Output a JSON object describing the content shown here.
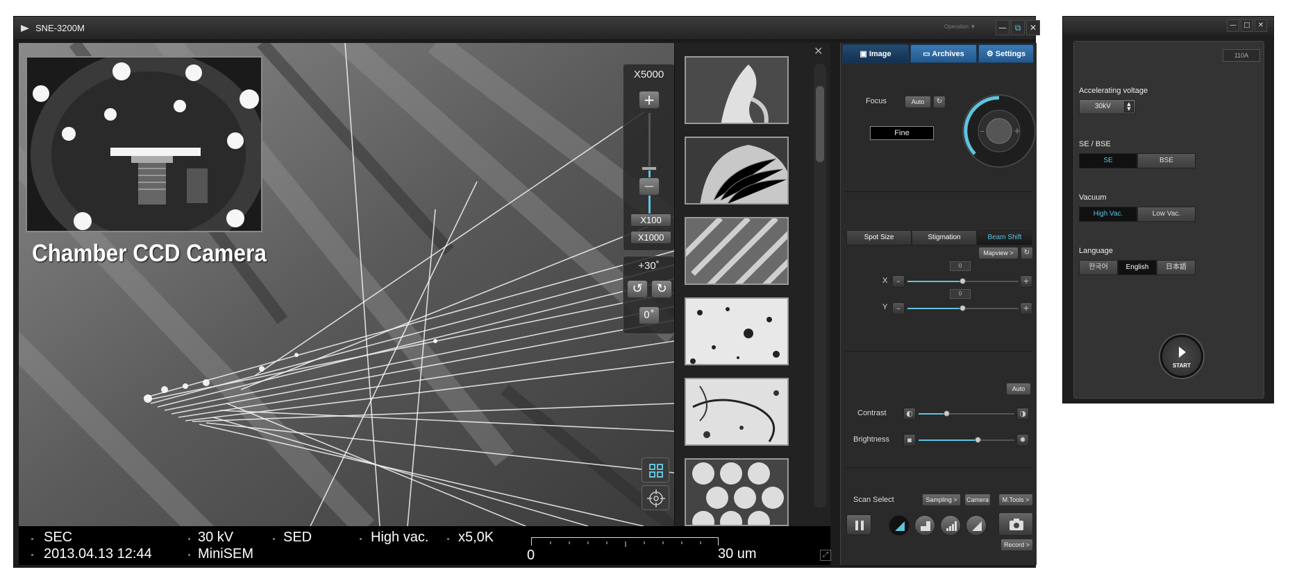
{
  "main_window": {
    "title": "SNE-3200M",
    "operation_menu": "Operation ▼",
    "window_controls": {
      "minimize": "—",
      "restore": "⧉",
      "close": "✕"
    }
  },
  "viewport": {
    "ccd_label": "Chamber CCD Camera",
    "zoom": {
      "readout": "X5000",
      "plus": "+",
      "minus": "—",
      "presets": [
        "X100",
        "X1000"
      ],
      "level": 0.5
    },
    "rotation": {
      "readout": "+30˚",
      "ccw": "↺",
      "cw": "↻",
      "reset": "0˚"
    }
  },
  "thumbnails": {
    "close": "✕",
    "count": 6
  },
  "status_bar": {
    "mode": "SEC",
    "datetime": "2013.04.13 12:44",
    "voltage": "30 kV",
    "device": "MiniSEM",
    "detector": "SED",
    "vacuum": "High vac.",
    "magnification": "x5,0K",
    "scale_start": "0",
    "scale_end": "30 um"
  },
  "control_panel": {
    "tabs": [
      "Image",
      "Archives",
      "Settings"
    ],
    "focus": {
      "label": "Focus",
      "auto": "Auto",
      "mode": "Fine"
    },
    "sub_tabs": [
      "Spot Size",
      "Stigmation",
      "Beam Shift"
    ],
    "mapview": "Mapview >",
    "beam_x": {
      "label": "X",
      "value": "0",
      "level": 0.5
    },
    "beam_y": {
      "label": "Y",
      "value": "0",
      "level": 0.5
    },
    "auto_contrast": "Auto",
    "contrast": {
      "label": "Contrast",
      "level": 0.3
    },
    "brightness": {
      "label": "Brightness",
      "level": 0.62
    },
    "scan_select": {
      "label": "Scan Select",
      "sampling": "Sampling >",
      "camera": "Camera",
      "mtools": "M.Tools >",
      "record": "Record >"
    }
  },
  "settings_window": {
    "window_controls": {
      "minimize": "—",
      "restore": "□",
      "close": "✕"
    },
    "emission_value": "110A",
    "accelerating_voltage": {
      "label": "Accelerating voltage",
      "value": "30kV"
    },
    "se_bse": {
      "label": "SE / BSE",
      "options": [
        "SE",
        "BSE"
      ],
      "selected": "SE"
    },
    "vacuum": {
      "label": "Vacuum",
      "options": [
        "High Vac.",
        "Low Vac."
      ],
      "selected": "High Vac."
    },
    "language": {
      "label": "Language",
      "options": [
        "한국어",
        "English",
        "日本語"
      ],
      "selected": "English"
    },
    "start": "START"
  },
  "colors": {
    "accent": "#5ec4e0",
    "tab_blue": "#3a7bb8",
    "panel_bg": "#2a2a2a"
  }
}
